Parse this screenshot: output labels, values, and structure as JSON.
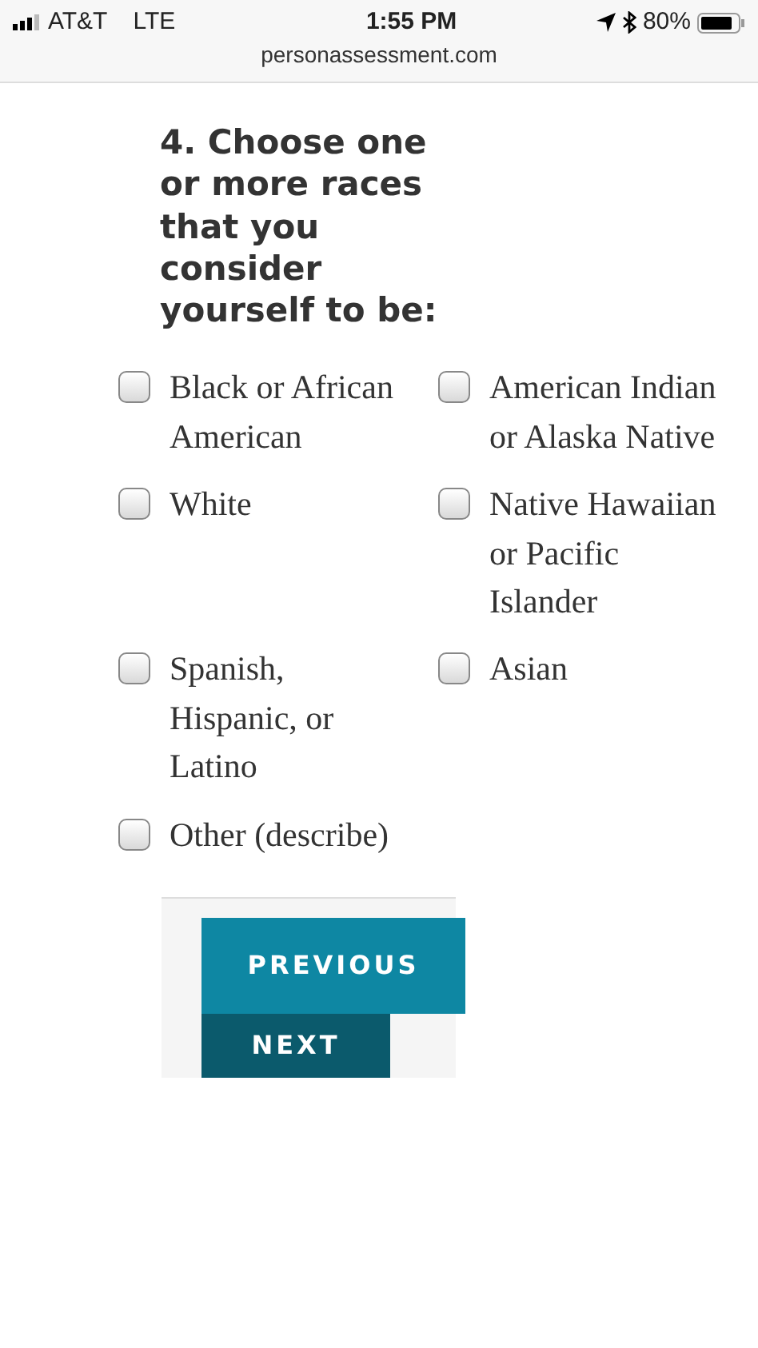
{
  "status_bar": {
    "carrier": "AT&T",
    "network": "LTE",
    "time": "1:55 PM",
    "battery": "80%"
  },
  "address_bar": {
    "url": "personassessment.com"
  },
  "question": {
    "title": "4. Choose one or more races that you consider yourself to be:",
    "options": [
      {
        "label": "Black or African American",
        "checked": false
      },
      {
        "label": "American Indian or Alaska Native",
        "checked": false
      },
      {
        "label": "White",
        "checked": false
      },
      {
        "label": "Native Hawaiian or Pacific Islander",
        "checked": false
      },
      {
        "label": "Spanish, Hispanic, or Latino",
        "checked": false
      },
      {
        "label": "Asian",
        "checked": false
      },
      {
        "label": "Other (describe)",
        "checked": false
      }
    ]
  },
  "buttons": [
    {
      "label": "PREVIOUS",
      "kind": "previous"
    },
    {
      "label": "NEXT",
      "kind": "next"
    }
  ]
}
